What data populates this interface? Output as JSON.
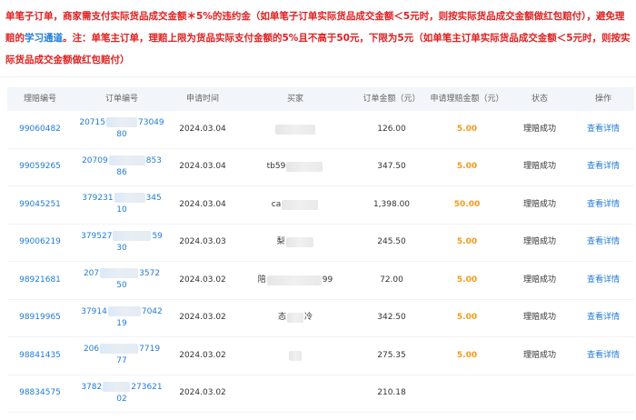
{
  "notice": {
    "part1": "单笔子订单，商家需支付实际货品成交金额＊5%的违约金（如单笔子订单实际货品成交金额＜5元时，则按实际货品成交金额做红包赔付），避免理赔的",
    "link": "学习通道",
    "part2": "。注：单笔主订单，理赔上限为货品实际支付金额的5%且不高于50元，下限为5元（如单笔主订单实际货品成交金额＜5元时，则按实际货品成交金额做红包赔付）"
  },
  "table": {
    "headers": [
      "理赔编号",
      "订单编号",
      "申请时间",
      "买家",
      "订单金额（元）",
      "申请理赔金额（元）",
      "状态",
      "操作"
    ],
    "rows": [
      {
        "claim_id": "99060482",
        "order_a": "20715",
        "order_b": "73049",
        "order_c": "80",
        "date": "2024.03.04",
        "buyer": "",
        "amount": "126.00",
        "claim_amount": "5.00",
        "status": "理赔成功",
        "action": "查看详情"
      },
      {
        "claim_id": "99059265",
        "order_a": "20709",
        "order_b": "853",
        "order_c": "86",
        "date": "2024.03.04",
        "buyer": "tb59",
        "amount": "347.50",
        "claim_amount": "5.00",
        "status": "理赔成功",
        "action": "查看详情"
      },
      {
        "claim_id": "99045251",
        "order_a": "379231",
        "order_b": "345",
        "order_c": "10",
        "date": "2024.03.04",
        "buyer": "ca",
        "amount": "1,398.00",
        "claim_amount": "50.00",
        "status": "理赔成功",
        "action": "查看详情"
      },
      {
        "claim_id": "99006219",
        "order_a": "379527",
        "order_b": "59",
        "order_c": "30",
        "date": "2024.03.03",
        "buyer": "梨",
        "amount": "245.50",
        "claim_amount": "5.00",
        "status": "理赔成功",
        "action": "查看详情"
      },
      {
        "claim_id": "98921681",
        "order_a": "207",
        "order_b": "3572",
        "order_c": "50",
        "date": "2024.03.02",
        "buyer": "陪",
        "buyer_suffix": "99",
        "amount": "72.00",
        "claim_amount": "5.00",
        "status": "理赔成功",
        "action": "查看详情"
      },
      {
        "claim_id": "98919965",
        "order_a": "37914",
        "order_b": "7042",
        "order_c": "19",
        "date": "2024.03.02",
        "buyer": "态",
        "buyer_suffix": "冷",
        "amount": "342.50",
        "claim_amount": "5.00",
        "status": "理赔成功",
        "action": "查看详情"
      },
      {
        "claim_id": "98841435",
        "order_a": "206",
        "order_b": "7719",
        "order_c": "77",
        "date": "2024.03.02",
        "buyer": "",
        "amount": "275.35",
        "claim_amount": "5.00",
        "status": "理赔成功",
        "action": "查看详情"
      },
      {
        "claim_id": "98834575",
        "order_a": "3782",
        "order_b": "273621",
        "order_c": "02",
        "date": "2024.03.02",
        "buyer": "",
        "amount": "210.18",
        "claim_amount": "",
        "status": "",
        "action": ""
      }
    ]
  },
  "colors": {
    "link": "#1f7bd8",
    "warning": "#e02020",
    "claim_amount": "#f29a1b"
  }
}
